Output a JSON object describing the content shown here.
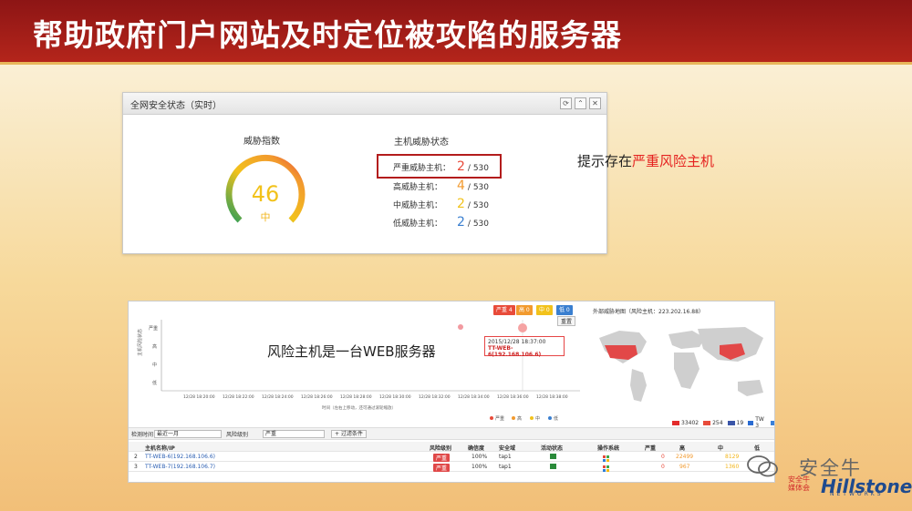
{
  "slide": {
    "title": "帮助政府门户网站及时定位被攻陷的服务器"
  },
  "panel1": {
    "title": "全网安全状态（实时）",
    "icons": [
      "refresh-icon",
      "collapse-icon",
      "close-icon"
    ],
    "threat_index_label": "威胁指数",
    "gauge_value": "46",
    "gauge_level": "中",
    "gauge_fraction": 0.46,
    "host_status_label": "主机威胁状态",
    "rows": [
      {
        "label": "严重威胁主机：",
        "value": "2",
        "total": "/ 530",
        "color": "#e84b3a"
      },
      {
        "label": "高威胁主机：",
        "value": "4",
        "total": "/ 530",
        "color": "#f29a2e"
      },
      {
        "label": "中威胁主机：",
        "value": "2",
        "total": "/ 530",
        "color": "#f2c21b"
      },
      {
        "label": "低威胁主机：",
        "value": "2",
        "total": "/ 530",
        "color": "#3a7fd0"
      }
    ]
  },
  "note1": {
    "prefix": "提示存在",
    "highlight": "严重风险主机"
  },
  "panel2": {
    "legend_tags": [
      {
        "label": "严重 4",
        "color": "#e84b3a"
      },
      {
        "label": "高 0",
        "color": "#f29a2e"
      },
      {
        "label": "中 0",
        "color": "#f2c21b"
      },
      {
        "label": "低 0",
        "color": "#3a7fd0"
      }
    ],
    "reset_label": "重置",
    "y_title": "主机风险状态",
    "y_ticks": [
      "严重",
      "高",
      "中",
      "低"
    ],
    "x_ticks": [
      "12/28 18:20:00",
      "12/28 18:22:00",
      "12/28 18:24:00",
      "12/28 18:26:00",
      "12/28 18:28:00",
      "12/28 18:30:00",
      "12/28 18:32:00",
      "12/28 18:34:00",
      "12/28 18:36:00",
      "12/28 18:38:00"
    ],
    "x_title": "时间（左右上移动，还可通过滚轮缩放）",
    "bottom_legend": [
      "严重",
      "高",
      "中",
      "低"
    ],
    "tooltip": {
      "time": "2015/12/28 18:37:00",
      "host": "TT-WEB-6(192.168.106.6)"
    },
    "note": "风险主机是一台WEB服务器",
    "map_title": "外部威胁地图（风险主机：223.202.16.88）",
    "map_legend": [
      {
        "flag": "cn",
        "value": "33402"
      },
      {
        "flag": "ca",
        "value": "254"
      },
      {
        "flag": "us",
        "value": "19"
      },
      {
        "flag": "tw",
        "value": "TW 3"
      },
      {
        "flag": "ua",
        "value": "1"
      }
    ],
    "filters": {
      "time_label": "检测时间",
      "time_value": "最近一月",
      "risk_label": "风险级别",
      "risk_value": "严重",
      "add_button": "+ 过滤条件"
    },
    "table": {
      "headers": [
        "主机名称/IP",
        "风险级别",
        "确信度",
        "安全域",
        "活动状态",
        "操作系统",
        "严重",
        "高",
        "中",
        "低"
      ],
      "group_header": "发现的威胁",
      "rows": [
        {
          "idx": "2",
          "host": "TT-WEB-6(192.168.106.6)",
          "risk": "严重",
          "conf": "100%",
          "zone": "tap1",
          "sev": "0",
          "high": "22499",
          "mid": "8129"
        },
        {
          "idx": "3",
          "host": "TT-WEB-7(192.168.106.7)",
          "risk": "严重",
          "conf": "100%",
          "zone": "tap1",
          "sev": "0",
          "high": "967",
          "mid": "1360"
        }
      ]
    }
  },
  "watermark": {
    "text": "安全牛",
    "brand": "Hillstone",
    "brand_sub": "NETWORKS",
    "media": "安全牛媒体会"
  }
}
